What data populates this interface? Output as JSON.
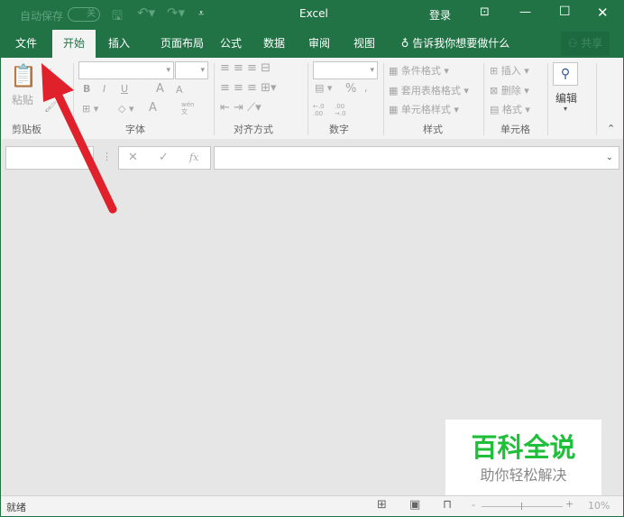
{
  "title_bar": {
    "autosave": "自动保存",
    "autosave_state": "关",
    "app_title": "Excel",
    "login": "登录"
  },
  "tabs": [
    "文件",
    "开始",
    "插入",
    "页面布局",
    "公式",
    "数据",
    "审阅",
    "视图"
  ],
  "tell_me": "告诉我你想要做什么",
  "share": "共享",
  "ribbon": {
    "clipboard": {
      "paste": "粘贴",
      "label": "剪贴板"
    },
    "font": {
      "bold": "B",
      "italic": "I",
      "underline": "U",
      "grow": "A",
      "shrink": "A",
      "color": "A",
      "phonetic": "wén 文",
      "label": "字体"
    },
    "alignment": {
      "label": "对齐方式"
    },
    "number": {
      "percent": "%",
      "comma": ",",
      "inc": "←.0 .00",
      "dec": ".00 →.0",
      "label": "数字"
    },
    "styles": {
      "conditional": "条件格式",
      "table": "套用表格格式",
      "cell": "单元格样式",
      "label": "样式"
    },
    "cells": {
      "insert": "插入",
      "delete": "删除",
      "format": "格式",
      "label": "单元格"
    },
    "editing": {
      "label": "编辑"
    }
  },
  "formula_bar": {
    "cancel": "✕",
    "enter": "✓",
    "fx": "fx"
  },
  "status": {
    "ready": "就绪",
    "zoom": "10%"
  },
  "watermark": {
    "title": "百科全说",
    "subtitle": "助你轻松解决"
  },
  "colors": {
    "brand": "#217346",
    "arrow": "#e0202a",
    "watermark": "#1fbf3a"
  }
}
